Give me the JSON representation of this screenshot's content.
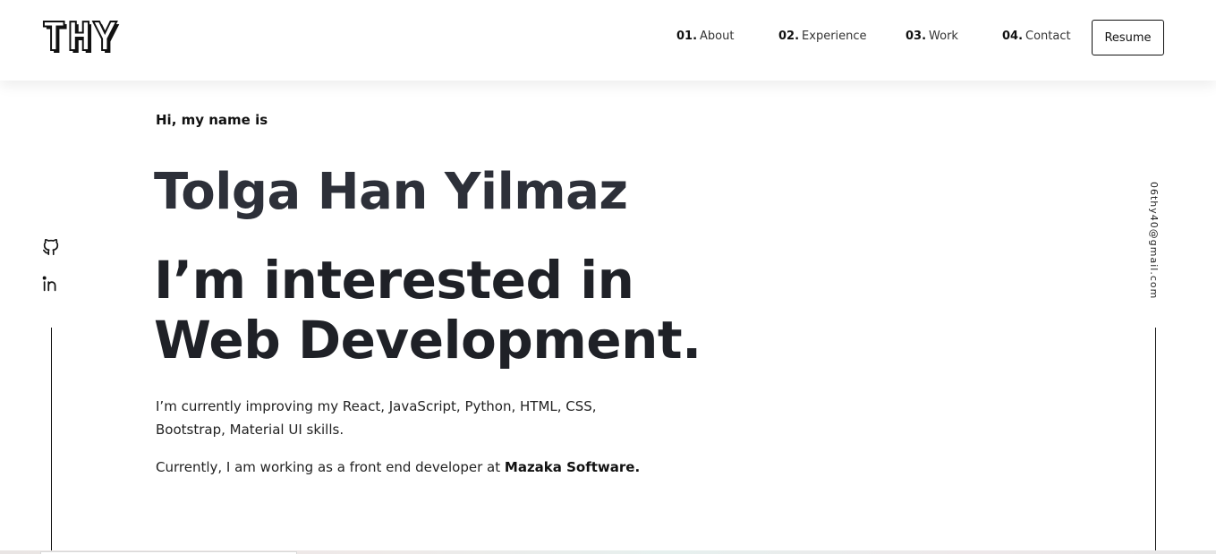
{
  "header": {
    "logo": "THY",
    "nav": [
      {
        "num": "01.",
        "label": "About"
      },
      {
        "num": "02.",
        "label": "Experience"
      },
      {
        "num": "03.",
        "label": "Work"
      },
      {
        "num": "04.",
        "label": "Contact"
      }
    ],
    "resume_label": "Resume"
  },
  "social": {
    "icons": [
      "github-icon",
      "linkedin-icon"
    ]
  },
  "email": "06thy40@gmail.com",
  "hero": {
    "greeting": "Hi, my name is",
    "name": "Tolga Han Yilmaz",
    "headline": "I’m interested in Web Development.",
    "intro": "I’m currently improving my React, JavaScript, Python, HTML, CSS, Bootstrap, Material UI skills.",
    "current_prefix": "Currently, I am working as a front end developer at ",
    "company": "Mazaka Software."
  },
  "colors": {
    "name": "#2d3039",
    "text": "#1f2127",
    "border": "#111111"
  }
}
